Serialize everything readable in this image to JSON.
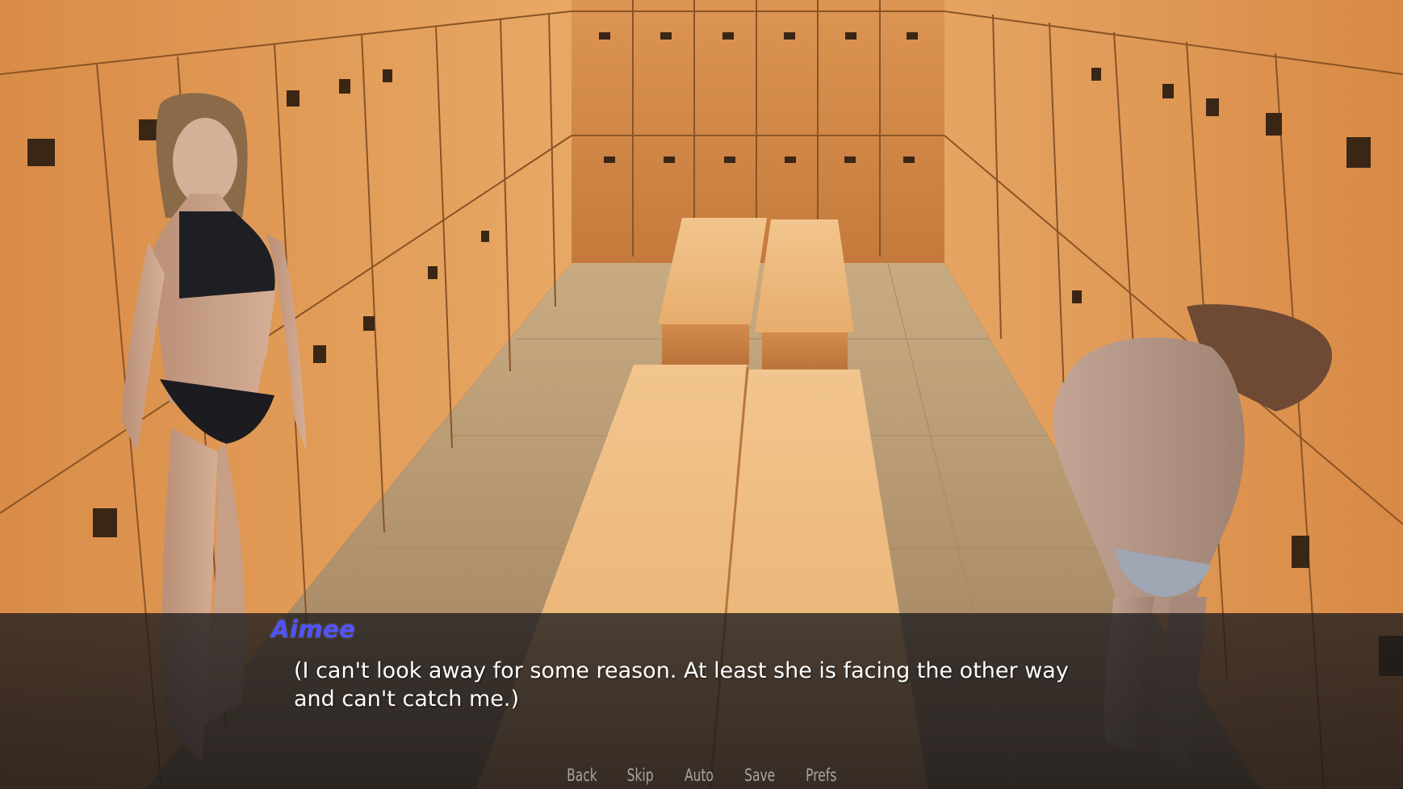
{
  "dialogue": {
    "speaker": "Aimee",
    "text": "(I can't look away for some reason. At least she is facing the other way and can't catch me.)"
  },
  "quick_menu": {
    "back": "Back",
    "skip": "Skip",
    "auto": "Auto",
    "save": "Save",
    "prefs": "Prefs"
  },
  "colors": {
    "speaker_name": "#4f52ff",
    "dialogue_text": "#ffffff",
    "quick_menu_text": "#a9a4a4",
    "locker_wood": "#d9904e"
  }
}
